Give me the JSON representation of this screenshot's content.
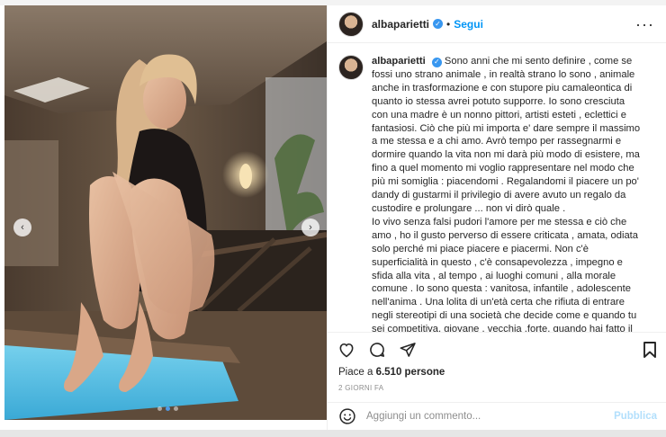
{
  "post": {
    "username": "albaparietti",
    "follow_label": "Segui",
    "separator": "•",
    "more_label": "···",
    "caption": [
      "Sono anni che mi sento definire , come se fossi uno strano animale , in realtà strano lo sono , animale anche in trasformazione e con stupore piu camaleontica di quanto io stessa avrei potuto supporre. Io sono cresciuta con una madre è un nonno pittori, artisti esteti , eclettici e fantasiosi. Ciò che più mi importa e' dare sempre il massimo a me stessa e a chi amo. Avrò tempo per rassegnarmi e dormire quando la vita non mi darà più modo di esistere, ma fino a quel momento mi voglio rappresentare nel modo che più mi somiglia : piacendomi . Regalandomi il piacere un po' dandy di gustarmi il privilegio di avere avuto un regalo da custodire e prolungare ... non vi dirò quale .",
      "Io vivo senza falsi pudori l'amore per me stessa e ciò che amo , ho il gusto perverso di essere criticata , amata, odiata solo perché mi piace piacere e piacermi. Non c'è superficialità in questo , c'è consapevolezza , impegno e sfida alla vita , al tempo , ai luoghi comuni , alla morale comune . Io sono questa : vanitosa, infantile , adolescente nell'anima . Una lolita di un'età certa che rifiuta di entrare negli stereotipi di una società che decide come e quando tu sei competitiva, giovane , vecchia ,forte, quando hai fatto il tuo tempo, quanto vale ancora il tuo tempo . E più il tempo passa più il mio tempo vale . Mi spiace per"
    ],
    "likes_prefix": "Piace a ",
    "likes_count": "6.510 persone",
    "timestamp": "2 GIORNI FA",
    "comment_placeholder": "Aggiungi un commento...",
    "publish_label": "Pubblica"
  },
  "carousel": {
    "prev_label": "‹",
    "next_label": "›",
    "slide_count": 3,
    "active_slide": 2
  },
  "icons": {
    "like": "heart-icon",
    "comment": "comment-icon",
    "share": "share-icon",
    "save": "bookmark-icon",
    "emoji": "emoji-icon",
    "verified": "verified-badge-icon"
  },
  "colors": {
    "accent": "#0095f6",
    "publish_disabled": "#b2dffc",
    "verified": "#3897f0",
    "pool_water": "#5ec6e8"
  }
}
